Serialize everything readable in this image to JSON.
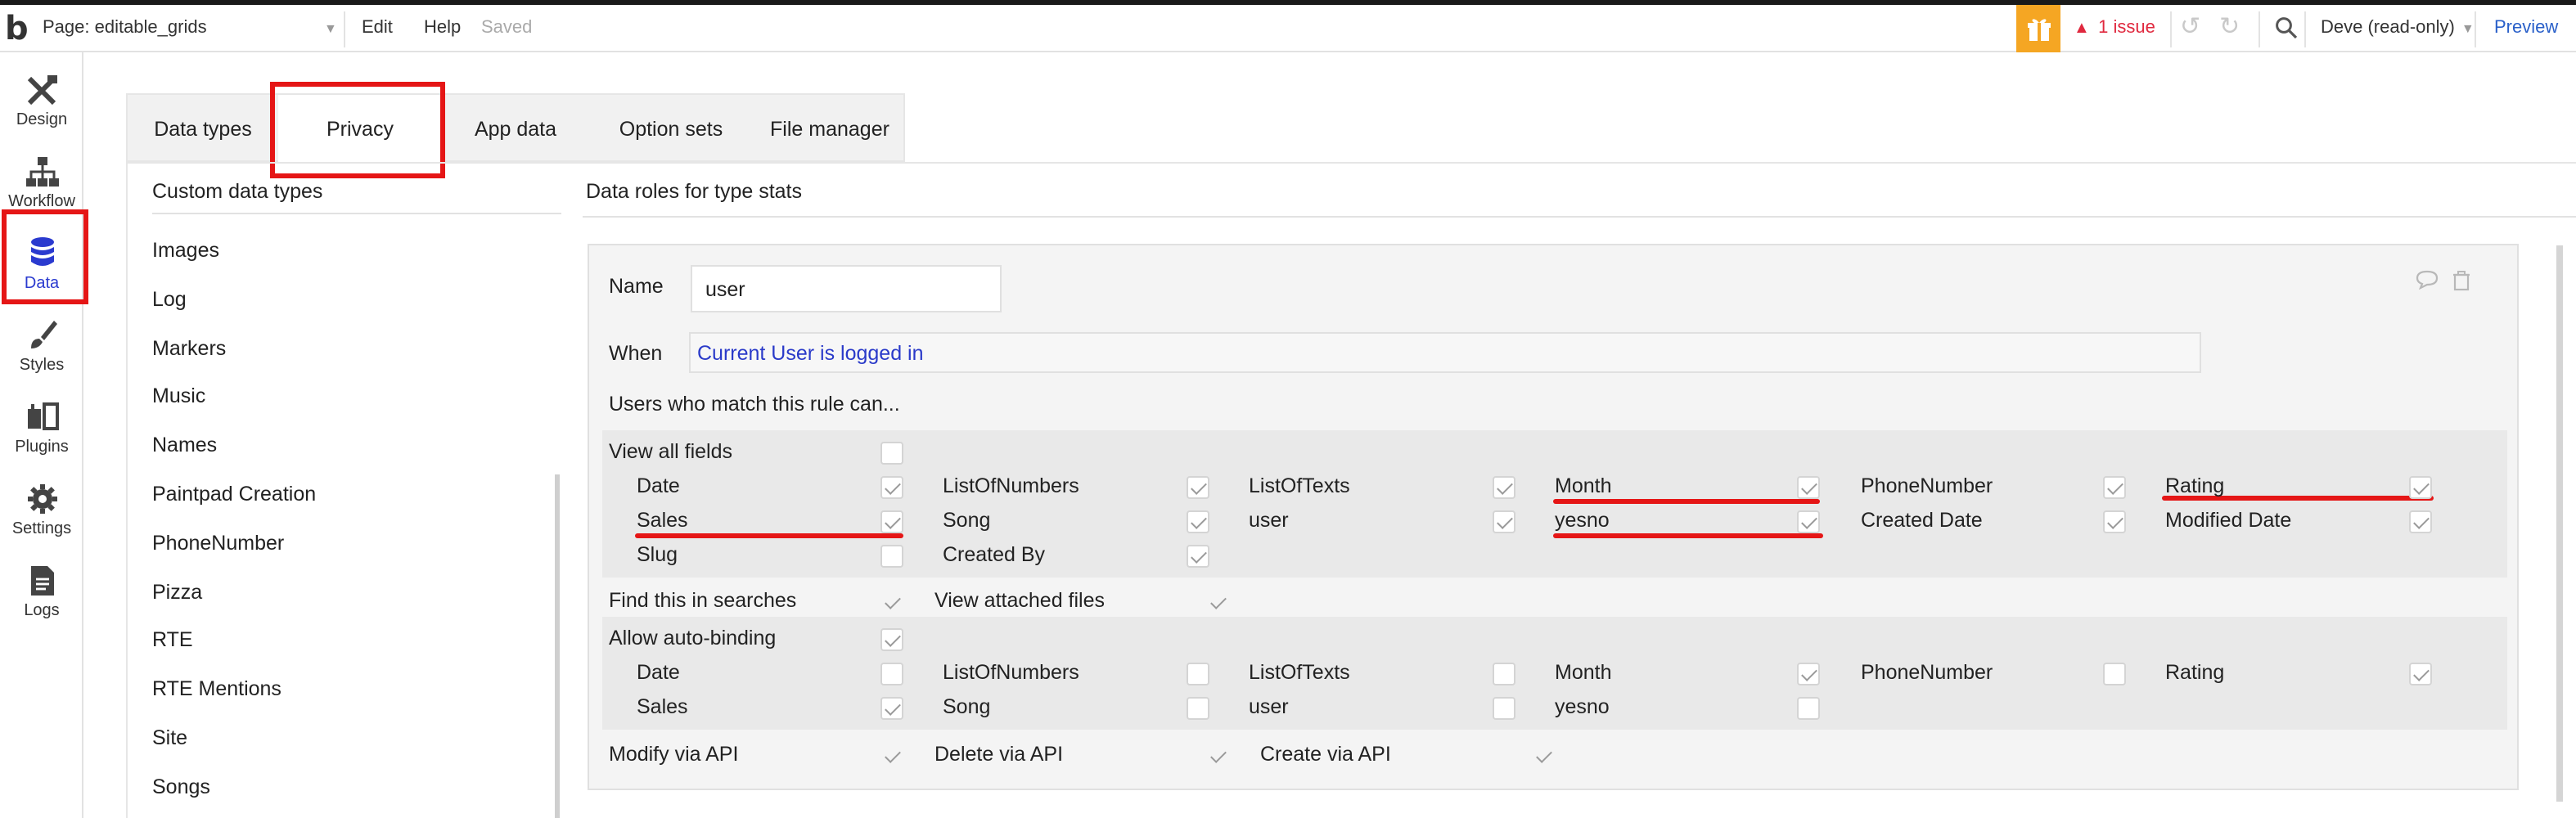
{
  "topbar": {
    "page_label": "Page: editable_grids",
    "menu": [
      "Edit",
      "Help"
    ],
    "saved_status": "Saved",
    "issue_label": "1 issue",
    "user_label": "Deve (read-only)",
    "preview_label": "Preview",
    "gift_color": "#f5a623",
    "issue_color": "#e0283e"
  },
  "rail": {
    "items": [
      {
        "label": "Design",
        "icon": "design-icon"
      },
      {
        "label": "Workflow",
        "icon": "workflow-icon"
      },
      {
        "label": "Data",
        "icon": "database-icon",
        "active": true
      },
      {
        "label": "Styles",
        "icon": "brush-icon"
      },
      {
        "label": "Plugins",
        "icon": "plugin-icon"
      },
      {
        "label": "Settings",
        "icon": "gear-icon"
      },
      {
        "label": "Logs",
        "icon": "document-icon"
      }
    ]
  },
  "tabs": [
    {
      "label": "Data types"
    },
    {
      "label": "Privacy",
      "active": true
    },
    {
      "label": "App data"
    },
    {
      "label": "Option sets"
    },
    {
      "label": "File manager"
    }
  ],
  "left_pane": {
    "heading": "Custom data types",
    "types": [
      "Images",
      "Log",
      "Markers",
      "Music",
      "Names",
      "Paintpad Creation",
      "PhoneNumber",
      "Pizza",
      "RTE",
      "RTE Mentions",
      "Site",
      "Songs"
    ]
  },
  "right_pane": {
    "heading": "Data roles for type stats",
    "rule": {
      "name_label": "Name",
      "name_value": "user",
      "when_label": "When",
      "when_value": "Current User is logged in",
      "intro": "Users who match this rule can...",
      "view_all_fields_label": "View all fields",
      "view_all_fields_checked": false,
      "fields": [
        {
          "name": "Date",
          "checked": true
        },
        {
          "name": "ListOfNumbers",
          "checked": true
        },
        {
          "name": "ListOfTexts",
          "checked": true
        },
        {
          "name": "Month",
          "checked": true
        },
        {
          "name": "PhoneNumber",
          "checked": true
        },
        {
          "name": "Rating",
          "checked": true
        },
        {
          "name": "Sales",
          "checked": true
        },
        {
          "name": "Song",
          "checked": true
        },
        {
          "name": "user",
          "checked": true
        },
        {
          "name": "yesno",
          "checked": true
        },
        {
          "name": "Created Date",
          "checked": true
        },
        {
          "name": "Modified Date",
          "checked": true
        },
        {
          "name": "Slug",
          "checked": false
        },
        {
          "name": "Created By",
          "checked": true
        }
      ],
      "find_in_searches_label": "Find this in searches",
      "find_in_searches_checked": true,
      "view_attached_files_label": "View attached files",
      "view_attached_files_checked": true,
      "auto_binding_label": "Allow auto-binding",
      "auto_binding_checked": true,
      "auto_binding_fields": [
        {
          "name": "Date",
          "checked": false
        },
        {
          "name": "ListOfNumbers",
          "checked": false
        },
        {
          "name": "ListOfTexts",
          "checked": false
        },
        {
          "name": "Month",
          "checked": true
        },
        {
          "name": "PhoneNumber",
          "checked": false
        },
        {
          "name": "Rating",
          "checked": true
        },
        {
          "name": "Sales",
          "checked": true
        },
        {
          "name": "Song",
          "checked": false
        },
        {
          "name": "user",
          "checked": false
        },
        {
          "name": "yesno",
          "checked": false
        }
      ],
      "modify_api_label": "Modify via API",
      "modify_api_checked": true,
      "delete_api_label": "Delete via API",
      "delete_api_checked": true,
      "create_api_label": "Create via API",
      "create_api_checked": true
    }
  },
  "annotation_color": "#e51616"
}
